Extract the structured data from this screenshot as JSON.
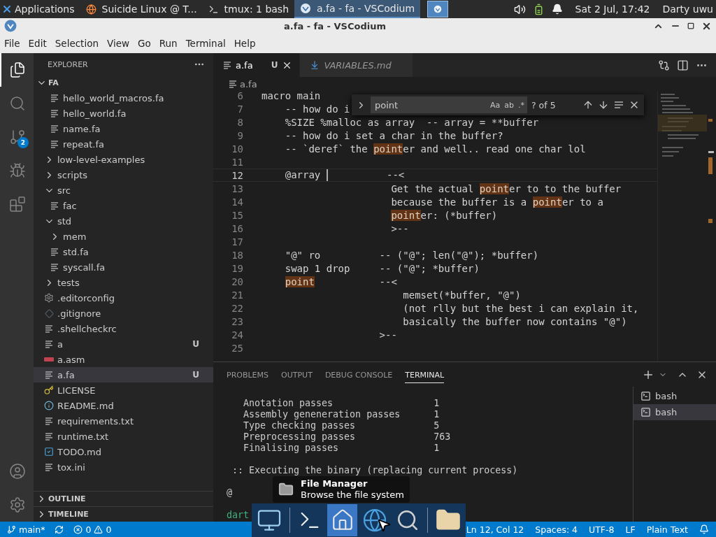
{
  "top_panel": {
    "menu_label": "Applications",
    "tasks": [
      {
        "label": "Suicide Linux @ T...",
        "kind": "browser",
        "selected": false
      },
      {
        "label": "tmux: 1 bash",
        "kind": "terminal",
        "selected": false
      },
      {
        "label": "a.fa - fa - VSCodium",
        "kind": "editor",
        "selected": true
      }
    ],
    "clock": "Sat  2 Jul, 17:42",
    "user": "Darty uwu"
  },
  "window": {
    "title": "a.fa - fa - VSCodium"
  },
  "menu": [
    "File",
    "Edit",
    "Selection",
    "View",
    "Go",
    "Run",
    "Terminal",
    "Help"
  ],
  "activity_bar": {
    "items": [
      {
        "kind": "files",
        "selected": true
      },
      {
        "kind": "search",
        "selected": false
      },
      {
        "kind": "source-control",
        "selected": false,
        "badge": "2"
      },
      {
        "kind": "debug",
        "selected": false
      },
      {
        "kind": "extensions",
        "selected": false
      }
    ],
    "bottom": [
      {
        "kind": "account"
      },
      {
        "kind": "settings"
      }
    ]
  },
  "explorer": {
    "title": "EXPLORER",
    "root": {
      "label": "FA",
      "expanded": true,
      "children": [
        {
          "kind": "group",
          "children": [
            {
              "label": "hello_world_macros.fa",
              "kind": "file",
              "selected": false
            },
            {
              "label": "hello_world.fa",
              "kind": "file",
              "selected": false
            },
            {
              "label": "name.fa",
              "kind": "file",
              "selected": false
            },
            {
              "label": "repeat.fa",
              "kind": "file",
              "selected": false
            }
          ]
        },
        {
          "label": "low-level-examples",
          "kind": "folder",
          "expanded": false,
          "selected": false
        },
        {
          "label": "scripts",
          "kind": "folder",
          "expanded": false,
          "selected": false
        },
        {
          "label": "src",
          "kind": "folder",
          "expanded": true,
          "selected": false,
          "children": [
            {
              "label": "fac",
              "kind": "file",
              "selected": false
            }
          ]
        },
        {
          "label": "std",
          "kind": "folder",
          "expanded": true,
          "selected": false,
          "children": [
            {
              "label": "mem",
              "kind": "folder",
              "expanded": false,
              "selected": false
            },
            {
              "label": "std.fa",
              "kind": "file",
              "selected": false
            },
            {
              "label": "syscall.fa",
              "kind": "file",
              "selected": false
            }
          ]
        },
        {
          "label": "tests",
          "kind": "folder",
          "expanded": false,
          "selected": false
        },
        {
          "label": ".editorconfig",
          "kind": "config",
          "selected": false
        },
        {
          "label": ".gitignore",
          "kind": "git",
          "selected": false
        },
        {
          "label": ".shellcheckrc",
          "kind": "file",
          "selected": false
        },
        {
          "label": "a",
          "kind": "file",
          "selected": false,
          "git": "U"
        },
        {
          "label": "a.asm",
          "kind": "asm",
          "selected": false
        },
        {
          "label": "a.fa",
          "kind": "file",
          "selected": true,
          "git": "U"
        },
        {
          "label": "LICENSE",
          "kind": "license",
          "selected": false
        },
        {
          "label": "README.md",
          "kind": "info",
          "selected": false
        },
        {
          "label": "requirements.txt",
          "kind": "file",
          "selected": false
        },
        {
          "label": "runtime.txt",
          "kind": "file",
          "selected": false
        },
        {
          "label": "TODO.md",
          "kind": "todo",
          "selected": false
        },
        {
          "label": "tox.ini",
          "kind": "file",
          "selected": false
        }
      ]
    },
    "sections": [
      {
        "label": "OUTLINE",
        "expanded": false
      },
      {
        "label": "TIMELINE",
        "expanded": false
      }
    ]
  },
  "editor_tabs": [
    {
      "label": "a.fa",
      "kind": "file",
      "selected": true,
      "preview": false,
      "git": "U"
    },
    {
      "label": "VARIABLES.md",
      "kind": "markdown",
      "selected": false,
      "preview": true
    }
  ],
  "breadcrumb": [
    "a.fa"
  ],
  "find": {
    "query": "point",
    "options": [
      "Aa",
      "ab",
      ".*"
    ],
    "count": "? of 5"
  },
  "code": {
    "lines": [
      {
        "number": "6",
        "current": false,
        "kind": "top",
        "segments": [
          {
            "kind": "text",
            "text": "macro main"
          }
        ]
      },
      {
        "number": "7",
        "current": false,
        "kind": "body",
        "segments": [
          {
            "kind": "text",
            "text": "-- how do i"
          }
        ]
      },
      {
        "number": "8",
        "current": false,
        "kind": "body",
        "segments": [
          {
            "kind": "text",
            "text": "%SIZE %malloc as array  -- array = **buffer"
          }
        ]
      },
      {
        "number": "9",
        "current": false,
        "kind": "body",
        "segments": [
          {
            "kind": "text",
            "text": "-- how do i set a char in the buffer?"
          }
        ]
      },
      {
        "number": "10",
        "current": false,
        "kind": "body",
        "segments": [
          {
            "kind": "text",
            "text": "-- `deref` the "
          },
          {
            "kind": "match",
            "text": "point"
          },
          {
            "kind": "text",
            "text": "er and well.. read one char lol"
          }
        ]
      },
      {
        "number": "11",
        "current": false
      },
      {
        "number": "12",
        "current": true,
        "kind": "body",
        "segments": [
          {
            "kind": "text",
            "text": "@array "
          },
          {
            "kind": "cursor"
          },
          {
            "kind": "text",
            "text": "          --<"
          }
        ]
      },
      {
        "number": "13",
        "current": false,
        "kind": "comment",
        "segments": [
          {
            "kind": "text",
            "text": "Get the actual "
          },
          {
            "kind": "match",
            "text": "point"
          },
          {
            "kind": "text",
            "text": "er to to the buffer"
          }
        ]
      },
      {
        "number": "14",
        "current": false,
        "kind": "comment",
        "segments": [
          {
            "kind": "text",
            "text": "because the buffer is a "
          },
          {
            "kind": "match",
            "text": "point"
          },
          {
            "kind": "text",
            "text": "er to a"
          }
        ]
      },
      {
        "number": "15",
        "current": false,
        "kind": "comment",
        "segments": [
          {
            "kind": "match",
            "text": "point"
          },
          {
            "kind": "text",
            "text": "er: (*buffer)"
          }
        ]
      },
      {
        "number": "16",
        "current": false,
        "kind": "comment",
        "segments": [
          {
            "kind": "text",
            "text": ">--"
          }
        ]
      },
      {
        "number": "17",
        "current": false
      },
      {
        "number": "18",
        "current": false,
        "kind": "body",
        "segments": [
          {
            "kind": "text",
            "text": "\"@\" ro          -- (\"@\"; len(\"@\"); *buffer)"
          }
        ]
      },
      {
        "number": "19",
        "current": false,
        "kind": "body",
        "segments": [
          {
            "kind": "text",
            "text": "swap 1 drop     -- (\"@\"; *buffer)"
          }
        ]
      },
      {
        "number": "20",
        "current": false,
        "kind": "body",
        "segments": [
          {
            "kind": "match",
            "text": "point"
          },
          {
            "kind": "text",
            "text": "           --<"
          }
        ]
      },
      {
        "number": "21",
        "current": false,
        "kind": "deep",
        "segments": [
          {
            "kind": "text",
            "text": "memset(*buffer, \"@\")"
          }
        ]
      },
      {
        "number": "22",
        "current": false,
        "kind": "deep",
        "segments": [
          {
            "kind": "text",
            "text": "(not rlly but the best i can explain it,"
          }
        ]
      },
      {
        "number": "23",
        "current": false,
        "kind": "deep",
        "segments": [
          {
            "kind": "text",
            "text": "basically the buffer now contains \"@\")"
          }
        ]
      },
      {
        "number": "24",
        "current": false,
        "kind": "block",
        "segments": [
          {
            "kind": "text",
            "text": ">--"
          }
        ]
      },
      {
        "number": "25",
        "current": false
      }
    ]
  },
  "panel": {
    "tabs": [
      {
        "label": "PROBLEMS",
        "selected": false
      },
      {
        "label": "OUTPUT",
        "selected": false
      },
      {
        "label": "DEBUG CONSOLE",
        "selected": false
      },
      {
        "label": "TERMINAL",
        "selected": true
      }
    ],
    "terminal_lines": [
      {
        "kind": "output",
        "text": "   Anotation passes                  1"
      },
      {
        "kind": "output",
        "text": "   Assembly geneneration passes      1"
      },
      {
        "kind": "output",
        "text": "   Type checking passes              5"
      },
      {
        "kind": "output",
        "text": "   Preprocessing passes              763"
      },
      {
        "kind": "output",
        "text": "   Finalising passes                 1"
      },
      {
        "kind": "blank"
      },
      {
        "kind": "output",
        "text": " :: Executing the binary (replacing current process)"
      },
      {
        "kind": "blank"
      },
      {
        "kind": "output",
        "text": "@"
      },
      {
        "kind": "blank"
      },
      {
        "kind": "prompt",
        "text": "dart"
      }
    ],
    "terminals": [
      {
        "label": "bash",
        "selected": false
      },
      {
        "label": "bash",
        "selected": true
      }
    ]
  },
  "status_bar": {
    "branch": "main*",
    "errors": "0",
    "warnings": "0",
    "right": [
      "Ln 12, Col 12",
      "Spaces: 4",
      "UTF-8",
      "LF",
      "Plain Text"
    ]
  },
  "dock": {
    "groups": [
      {
        "items": [
          {
            "kind": "desktop",
            "selected": false
          }
        ]
      },
      {
        "items": [
          {
            "kind": "terminal",
            "selected": false
          },
          {
            "kind": "home-folder",
            "selected": true
          },
          {
            "kind": "browser",
            "selected": false
          },
          {
            "kind": "search",
            "selected": false
          }
        ]
      },
      {
        "items": [
          {
            "kind": "folder",
            "selected": false
          }
        ]
      }
    ]
  },
  "tooltip": {
    "title": "File Manager",
    "text": "Browse the file system"
  }
}
